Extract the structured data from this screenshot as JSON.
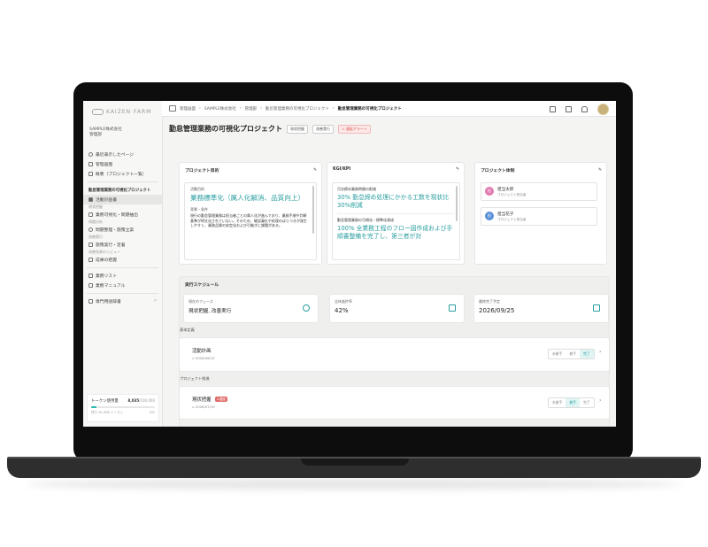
{
  "sidebar": {
    "logo": "KAIZEN FARM",
    "company": "SAMPLE株式会社",
    "department": "管理部",
    "recent": "最近表示したページ",
    "items_top": [
      "管理画面",
      "概要（プロジェクト一覧）"
    ],
    "project_name": "勤怠管理業務の可視化プロジェクト",
    "active_item": "活動計画書",
    "groups": [
      {
        "section": "現状把握",
        "label": "業務可視化・問題抽出"
      },
      {
        "section": "問題分析",
        "label": "問題整理・施策立案"
      },
      {
        "section": "改善実行",
        "label": "施策実行・定着"
      },
      {
        "section": "改善効果のレビュー",
        "label": "成果の把握"
      }
    ],
    "items_bottom": [
      "業務リスト",
      "業務マニュアル"
    ],
    "glossary": "専門用語辞書",
    "token": {
      "label": "トークン使用量",
      "value": "8,035",
      "max": "/100,000",
      "remaining": "残り 91,965 トークン",
      "percent": "8%",
      "fraction": 0.08
    }
  },
  "breadcrumb": [
    "管理画面",
    "SAMPLE株式会社",
    "管理部",
    "勤怠管理業務の可視化プロジェクト",
    "勤怠管理業務の可視化プロジェクト"
  ],
  "page": {
    "title": "勤怠管理業務の可視化プロジェクト",
    "tags": [
      "現状把握",
      "改善実行"
    ],
    "alert": "遅延アラート"
  },
  "goals_card": {
    "title": "プロジェクト目的",
    "activity_label": "活動目的",
    "activity_goal": "業務標準化（属人化解消、品質向上）",
    "background_label": "背景・条件",
    "background_text": "現行の勤怠管理業務は担当者ごとの属人化が進んでおり、業務手順や判断基準が明文化されていない。そのため、確認漏れや処理のばらつきが発生しやすく、業務品質の安定化および引継ぎに課題がある。"
  },
  "kgi_card": {
    "title": "KGI/KPI",
    "item1_label": "月次締め業務時間の削減",
    "item1_text": "30% 勤怠締め処理にかかる工数を現状比30%削減",
    "item2_label": "勤怠管理業務の可視化・標準化達成",
    "item2_text": "100% 全業務工程のフロー図作成および手順書整備を完了し、第三者が対"
  },
  "team_card": {
    "title": "プロジェクト体制",
    "members": [
      {
        "initial": "担",
        "name": "担当太郎",
        "role": "プロジェクト担当者"
      },
      {
        "initial": "担",
        "name": "担当花子",
        "role": "プロジェクト担当者"
      }
    ]
  },
  "schedule": {
    "title": "実行スケジュール",
    "stats": [
      {
        "label": "現在のフェーズ",
        "value": "現状把握, 改善実行"
      },
      {
        "label": "全体進捗率",
        "value": "42%"
      },
      {
        "label": "最終完了予定",
        "value": "2026/09/25"
      }
    ],
    "basic_section": "基本定義",
    "basic_item": {
      "title": "活動計画",
      "date": "2026/06/15"
    },
    "progress_section": "プロジェクト推進",
    "progress_item": {
      "title": "現状把握",
      "badge": "遅延",
      "date": "2026/07/10"
    },
    "status_options": [
      "未着手",
      "着手",
      "完了"
    ],
    "basic_selected": "完了",
    "progress_selected": "着手"
  }
}
